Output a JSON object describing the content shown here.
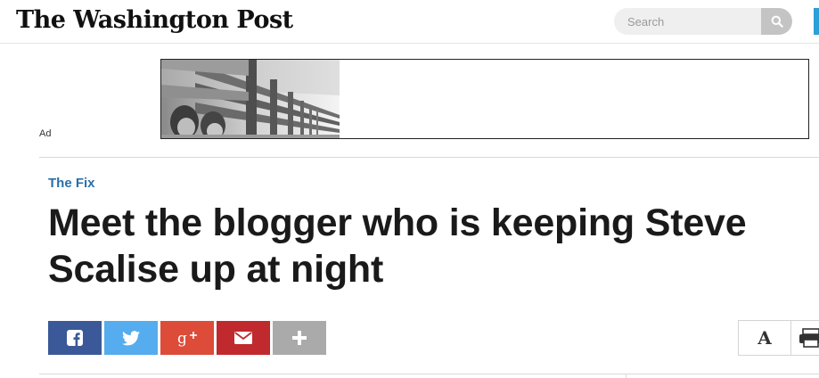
{
  "masthead": {
    "logo_text": "The Washington Post",
    "search": {
      "placeholder": "Search",
      "value": ""
    },
    "search_icon": "search-icon"
  },
  "ad": {
    "label": "Ad"
  },
  "article": {
    "section": "The Fix",
    "headline": "Meet the blogger who is keeping Steve Scalise up at night"
  },
  "share": {
    "buttons": [
      {
        "name": "facebook",
        "icon": "facebook-icon",
        "color": "#3b5998"
      },
      {
        "name": "twitter",
        "icon": "twitter-icon",
        "color": "#55acee"
      },
      {
        "name": "google-plus",
        "icon": "google-plus-icon",
        "color": "#dd4b39"
      },
      {
        "name": "email",
        "icon": "email-icon",
        "color": "#c0292d"
      },
      {
        "name": "more",
        "icon": "plus-icon",
        "color": "#aaaaaa"
      }
    ]
  },
  "tools": {
    "font_size_glyph": "A",
    "print_icon": "print-icon"
  },
  "colors": {
    "accent": "#2a6fa9",
    "brand_edge": "#2a9fd8"
  }
}
